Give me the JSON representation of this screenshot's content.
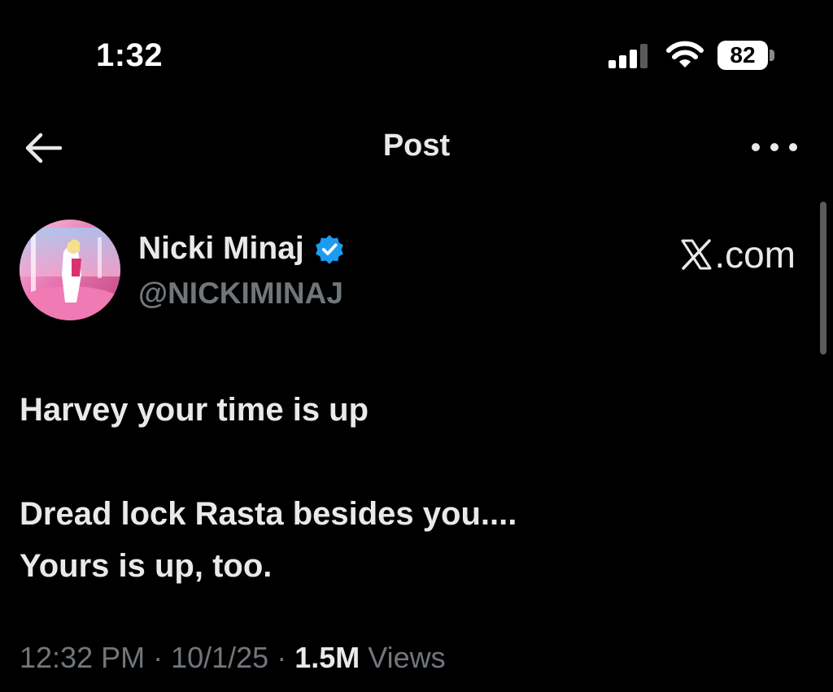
{
  "status_bar": {
    "time": "1:32",
    "battery_level": "82",
    "signal_bars_active": 3,
    "icons": [
      "cellular-signal-icon",
      "wifi-icon",
      "battery-icon"
    ]
  },
  "header": {
    "title": "Post",
    "back_icon": "back-arrow-icon",
    "more_icon": "more-options-icon"
  },
  "author": {
    "name": "Nicki Minaj",
    "handle": "@NICKIMINAJ",
    "verified": true,
    "verified_color": "#1d9bf0"
  },
  "watermark": {
    "text": ".com",
    "icon": "x-logo-icon"
  },
  "post": {
    "lines": [
      "Harvey your time is up",
      "Dread lock Rasta besides you....",
      "Yours is up, too."
    ]
  },
  "meta": {
    "time": "12:32 PM",
    "separator": " · ",
    "date": "10/1/25",
    "views_count": "1.5M",
    "views_label": " Views"
  },
  "colors": {
    "background": "#000000",
    "primary_text": "#e7e9ea",
    "secondary_text": "#71767b",
    "accent": "#1d9bf0"
  }
}
